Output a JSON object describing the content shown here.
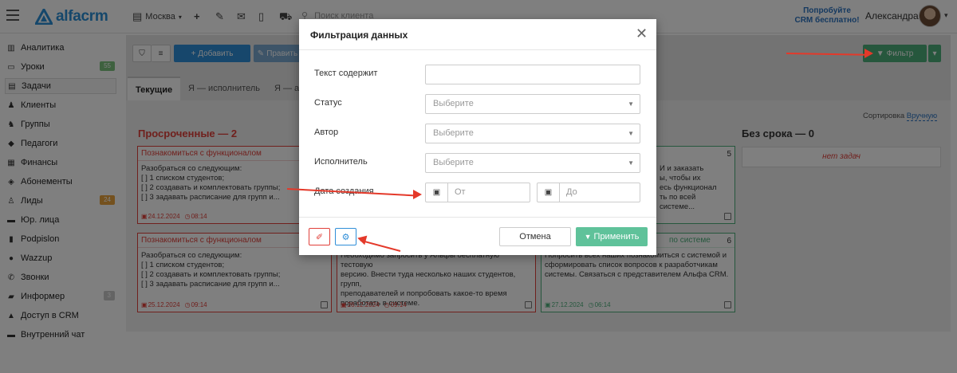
{
  "topbar": {
    "logo_text": "alfacrm",
    "city": "Москва",
    "search_placeholder": "Поиск клиента",
    "promo_line1": "Попробуйте",
    "promo_line2": "CRM бесплатно!",
    "user_name": "Александра"
  },
  "sidebar": {
    "items": [
      {
        "label": "Аналитика",
        "icon": "chart-icon"
      },
      {
        "label": "Уроки",
        "icon": "calendar-icon",
        "badge": "55",
        "badge_color": "#7cc27f"
      },
      {
        "label": "Задачи",
        "icon": "tasks-icon"
      },
      {
        "label": "Клиенты",
        "icon": "user-icon"
      },
      {
        "label": "Группы",
        "icon": "group-icon"
      },
      {
        "label": "Педагоги",
        "icon": "graduation-icon"
      },
      {
        "label": "Финансы",
        "icon": "money-icon"
      },
      {
        "label": "Абонементы",
        "icon": "tag-icon"
      },
      {
        "label": "Лиды",
        "icon": "add-user-icon",
        "badge": "24",
        "badge_color": "#e8a33d"
      },
      {
        "label": "Юр. лица",
        "icon": "briefcase-icon"
      },
      {
        "label": "Podpislon",
        "icon": "document-icon"
      },
      {
        "label": "Wazzup",
        "icon": "whatsapp-icon"
      },
      {
        "label": "Звонки",
        "icon": "phone-icon"
      },
      {
        "label": "Информер",
        "icon": "server-icon",
        "badge": "3",
        "badge_color": "#c9c9c9"
      },
      {
        "label": "Доступ в CRM",
        "icon": "lock-icon"
      },
      {
        "label": "Внутренний чат",
        "icon": "chat-icon"
      }
    ]
  },
  "toolbar": {
    "add_label": "+ Добавить",
    "edit_label": "Править",
    "filter_label": "Фильтр"
  },
  "tabs": [
    "Текущие",
    "Я — исполнитель",
    "Я — ав"
  ],
  "board": {
    "sort_prefix": "Сортировка",
    "sort_value": "Вручную",
    "overdue_title": "Просроченные — 2",
    "no_deadline_title": "Без срока — 0",
    "no_tasks": "нет задач",
    "cards": [
      {
        "title": "Познакомиться с функционалом",
        "body": "Разобраться со следующим:\n[ ] 1 списком студентов;\n[ ] 2 создавать и комплектовать группы;\n[ ] 3 задавать расписание для групп и...",
        "date": "24.12.2024",
        "time": "08:14"
      },
      {
        "title": "Познакомиться с функционалом",
        "body": "Разобраться со следующим:\n[ ] 1 списком студентов;\n[ ] 2 создавать и комплектовать группы;\n[ ] 3 задавать расписание для групп и...",
        "date": "25.12.2024",
        "time": "09:14"
      },
      {
        "title": "",
        "body": "Необходимо запросить у Альфы бесплатную тестовую\nверсию. Внести туда несколько наших студентов, групп,\nпреподавателей и попробовать какое-то время\nпоработать в системе.",
        "date": "26.12.2024",
        "time": "09:14"
      },
      {
        "title": "по системе",
        "count": "6",
        "body": "Попросить всех наших познакомиться с системой и\nсформировать список вопросов к разработчикам\nсистемы. Связаться с представителем Альфа CRM.",
        "date": "27.12.2024",
        "time": "06:14"
      },
      {
        "title": "",
        "count": "5",
        "body": "И и заказать\nы, чтобы их\nесь функционал\nть по всей системе...",
        "date": "",
        "time": ""
      }
    ]
  },
  "modal": {
    "title": "Фильтрация данных",
    "fields": {
      "text_label": "Текст содержит",
      "status_label": "Статус",
      "status_value": "Выберите",
      "author_label": "Автор",
      "author_value": "Выберите",
      "executor_label": "Исполнитель",
      "executor_value": "Выберите",
      "date_label": "Дата создания",
      "date_from": "От",
      "date_to": "До"
    },
    "cancel_label": "Отмена",
    "apply_label": "Применить"
  },
  "colors": {
    "accent_green": "#4cae7b",
    "accent_blue": "#2f8ed8",
    "overdue_red": "#e0403a",
    "arrow_red": "#e4392a"
  }
}
